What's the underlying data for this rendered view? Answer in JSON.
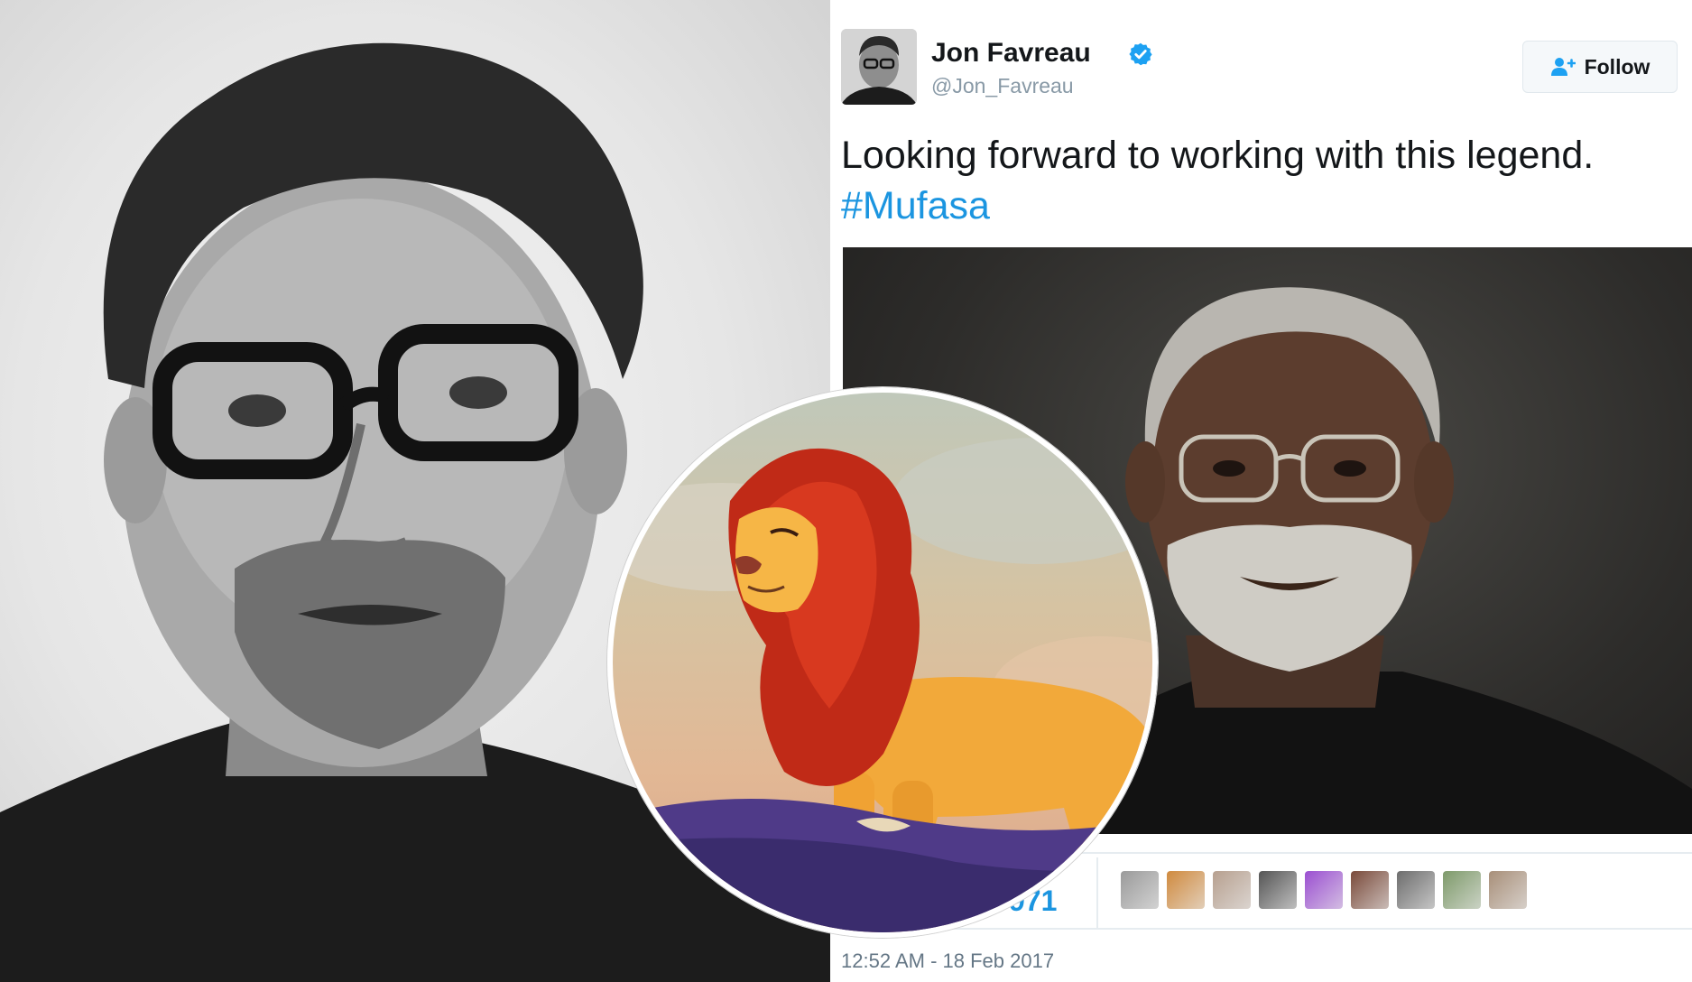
{
  "tweet": {
    "display_name": "Jon Favreau",
    "handle": "@Jon_Favreau",
    "follow_label": "Follow",
    "text": "Looking forward to working with this legend.",
    "hashtag": "#Mufasa",
    "likes_partial": "971",
    "timestamp": "12:52 AM - 18 Feb 2017",
    "liker_colors": [
      "#9a9a9a",
      "#d08a3e",
      "#b7a08f",
      "#555555",
      "#9b4fd1",
      "#7a4a3a",
      "#6d6d6d",
      "#7e9a6a",
      "#a88f79"
    ]
  },
  "colors": {
    "link": "#1b95e0",
    "verified": "#1da1f2",
    "text": "#14171a",
    "muted": "#8899a6"
  },
  "icons": {
    "verified": "verified-badge-icon",
    "follow": "add-person-icon"
  }
}
